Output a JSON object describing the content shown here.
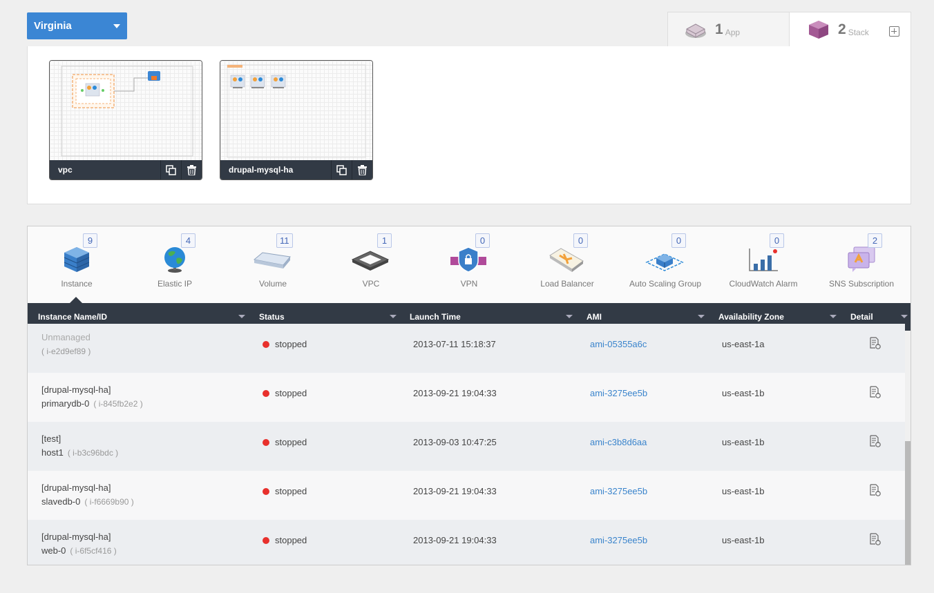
{
  "region": {
    "label": "Virginia",
    "icon": "caret-down-icon"
  },
  "top_tabs": [
    {
      "count": "1",
      "label": "App",
      "icon": "app-cube-icon"
    },
    {
      "count": "2",
      "label": "Stack",
      "icon": "stack-cube-icon",
      "add_icon": "add-icon"
    }
  ],
  "stacks": [
    {
      "name": "vpc",
      "duplicate_icon": "duplicate-icon",
      "delete_icon": "trash-icon"
    },
    {
      "name": "drupal-mysql-ha",
      "duplicate_icon": "duplicate-icon",
      "delete_icon": "trash-icon"
    }
  ],
  "resource_tabs": [
    {
      "label": "Instance",
      "count": "9",
      "icon": "instance-server-icon",
      "selected": true
    },
    {
      "label": "Elastic IP",
      "count": "4",
      "icon": "globe-icon"
    },
    {
      "label": "Volume",
      "count": "11",
      "icon": "volume-disk-icon"
    },
    {
      "label": "VPC",
      "count": "1",
      "icon": "vpc-frame-icon"
    },
    {
      "label": "VPN",
      "count": "0",
      "icon": "vpn-shield-icon"
    },
    {
      "label": "Load Balancer",
      "count": "0",
      "icon": "load-balancer-icon"
    },
    {
      "label": "Auto Scaling Group",
      "count": "0",
      "icon": "auto-scaling-icon"
    },
    {
      "label": "CloudWatch Alarm",
      "count": "0",
      "icon": "cloudwatch-chart-icon"
    },
    {
      "label": "SNS Subscription",
      "count": "2",
      "icon": "sns-chat-icon"
    }
  ],
  "table": {
    "columns": [
      "Instance Name/ID",
      "Status",
      "Launch Time",
      "AMI",
      "Availability Zone",
      "Detail"
    ],
    "rows": [
      {
        "group": "Unmanaged",
        "name": "",
        "id": "( i-e2d9ef89 )",
        "status": "stopped",
        "launch": "2013-07-11 15:18:37",
        "ami": "ami-05355a6c",
        "az": "us-east-1a"
      },
      {
        "group": "[drupal-mysql-ha]",
        "name": "primarydb-0",
        "id": "( i-845fb2e2 )",
        "status": "stopped",
        "launch": "2013-09-21 19:04:33",
        "ami": "ami-3275ee5b",
        "az": "us-east-1b"
      },
      {
        "group": "[test]",
        "name": "host1",
        "id": "( i-b3c96bdc )",
        "status": "stopped",
        "launch": "2013-09-03 10:47:25",
        "ami": "ami-c3b8d6aa",
        "az": "us-east-1b"
      },
      {
        "group": "[drupal-mysql-ha]",
        "name": "slavedb-0",
        "id": "( i-f6669b90 )",
        "status": "stopped",
        "launch": "2013-09-21 19:04:33",
        "ami": "ami-3275ee5b",
        "az": "us-east-1b"
      },
      {
        "group": "[drupal-mysql-ha]",
        "name": "web-0",
        "id": "( i-6f5cf416 )",
        "status": "stopped",
        "launch": "2013-09-21 19:04:33",
        "ami": "ami-3275ee5b",
        "az": "us-east-1b"
      }
    ],
    "status_color": "#e8302c",
    "detail_icon": "detail-doc-icon"
  },
  "colors": {
    "accent": "#3b86d4",
    "header_dark": "#323a45",
    "link": "#3a84cc"
  }
}
